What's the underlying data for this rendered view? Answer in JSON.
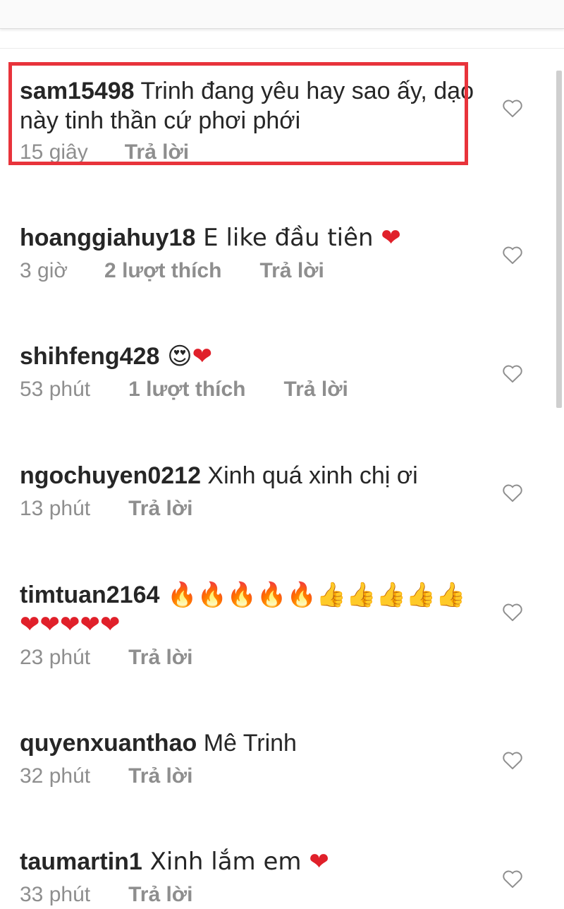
{
  "colors": {
    "highlight": "#e8333b",
    "meta": "#8e8e8e",
    "text": "#262626"
  },
  "icons": {
    "like": "heart-outline-icon"
  },
  "comments": [
    {
      "user": "sam15498",
      "text": " Trinh đang yêu hay sao ấy, dạo này tinh thần cứ phơi phới",
      "time": "15 giây",
      "likes": "",
      "reply": "Trả lời"
    },
    {
      "user": "hoanggiahuy18",
      "text": " E like đầu tiên ❤",
      "time": "3 giờ",
      "likes": "2 lượt thích",
      "reply": "Trả lời"
    },
    {
      "user": "shihfeng428",
      "text": " 😍❤",
      "time": "53 phút",
      "likes": "1 lượt thích",
      "reply": "Trả lời"
    },
    {
      "user": "ngochuyen0212",
      "text": " Xinh quá xinh chị ơi",
      "time": "13 phút",
      "likes": "",
      "reply": "Trả lời"
    },
    {
      "user": "timtuan2164",
      "text": " 🔥🔥🔥🔥🔥👍👍👍👍👍❤❤❤❤❤",
      "time": "23 phút",
      "likes": "",
      "reply": "Trả lời"
    },
    {
      "user": "quyenxuanthao",
      "text": " Mê Trinh",
      "time": "32 phút",
      "likes": "",
      "reply": "Trả lời"
    },
    {
      "user": "taumartin1",
      "text": " Xinh lắm em ❤",
      "time": "33 phút",
      "likes": "",
      "reply": "Trả lời"
    }
  ]
}
